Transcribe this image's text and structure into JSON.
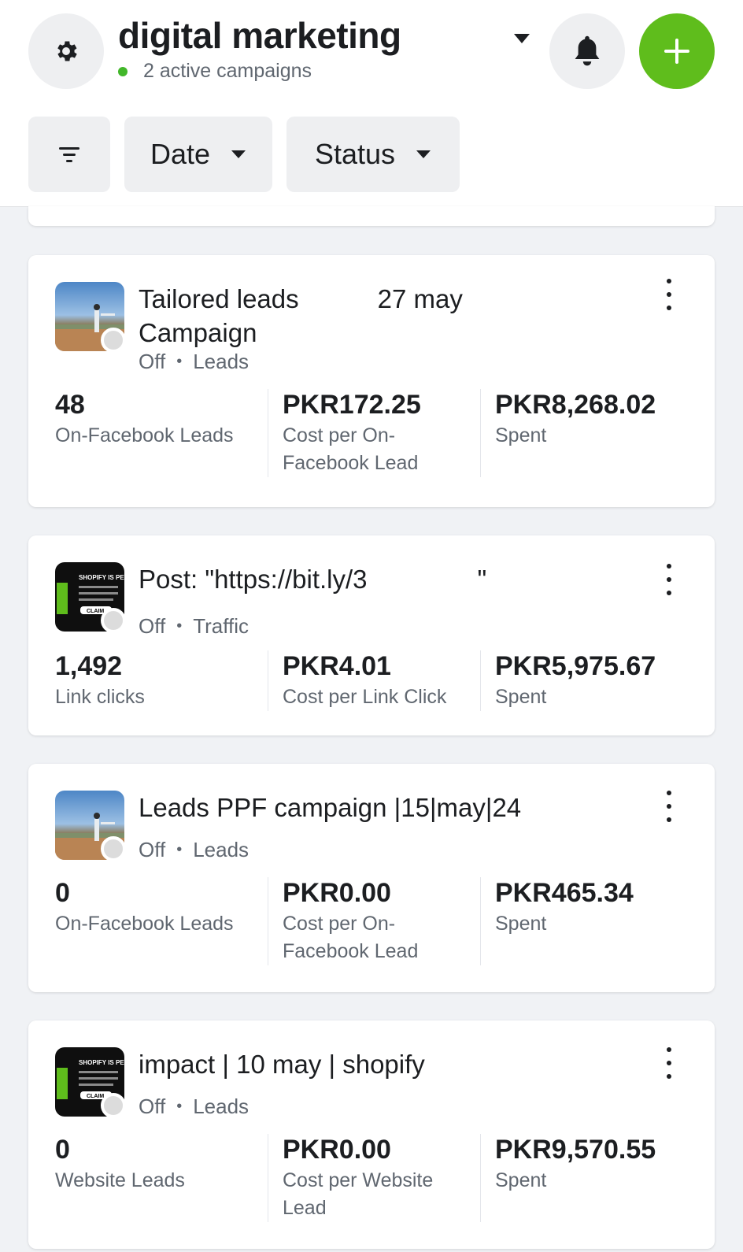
{
  "header": {
    "title": "digital marketing",
    "subtitle": "2 active campaigns",
    "icons": {
      "settings": "gear-icon",
      "notifications": "bell-icon",
      "add": "plus-icon",
      "title_dropdown": "caret-down-icon"
    },
    "add_color": "#5fbd1c"
  },
  "filters": {
    "filter_icon": "filter-icon",
    "date_label": "Date",
    "status_label": "Status"
  },
  "campaigns": [
    {
      "title_line1": "Tailored leads",
      "title_line1_end": "27 may",
      "title_line2": "Campaign",
      "status": "Off",
      "separator": "•",
      "objective": "Leads",
      "metrics": [
        {
          "value": "48",
          "label": "On-Facebook Leads"
        },
        {
          "value": "PKR172.25",
          "label": "Cost per On-Facebook Lead"
        },
        {
          "value": "PKR8,268.02",
          "label": "Spent"
        }
      ]
    },
    {
      "title": "Post: \"https://bit.ly/3",
      "title_end": "\"",
      "status": "Off",
      "separator": "•",
      "objective": "Traffic",
      "metrics": [
        {
          "value": "1,492",
          "label": "Link clicks"
        },
        {
          "value": "PKR4.01",
          "label": "Cost per Link Click"
        },
        {
          "value": "PKR5,975.67",
          "label": "Spent"
        }
      ]
    },
    {
      "title": "Leads PPF campaign |15|may|24",
      "status": "Off",
      "separator": "•",
      "objective": "Leads",
      "metrics": [
        {
          "value": "0",
          "label": "On-Facebook Leads"
        },
        {
          "value": "PKR0.00",
          "label": "Cost per On-Facebook Lead"
        },
        {
          "value": "PKR465.34",
          "label": "Spent"
        }
      ]
    },
    {
      "title": "impact | 10 may | shopify",
      "status": "Off",
      "separator": "•",
      "objective": "Leads",
      "metrics": [
        {
          "value": "0",
          "label": "Website Leads"
        },
        {
          "value": "PKR0.00",
          "label": "Cost per Website Lead"
        },
        {
          "value": "PKR9,570.55",
          "label": "Spent"
        }
      ]
    }
  ],
  "thumbnail_text": {
    "shopify_ad": "SHOPIFY IS PER",
    "shopify_button": "CLAIM"
  }
}
